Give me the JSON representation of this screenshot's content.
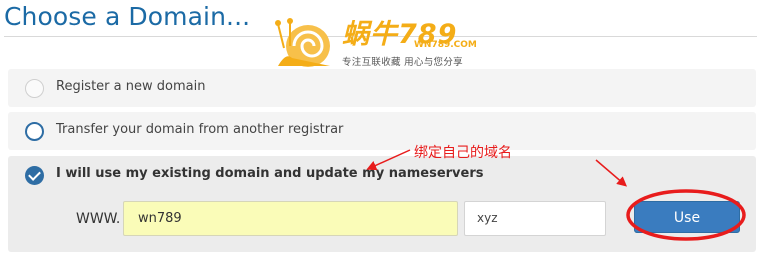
{
  "header": {
    "title": "Choose a Domain..."
  },
  "watermark": {
    "brand": "蜗牛789",
    "domain": "WN789.COM",
    "tagline": "专注互联收藏    用心与您分享"
  },
  "options": [
    {
      "label": "Register a new domain",
      "state": "unselected"
    },
    {
      "label": "Transfer your domain from another registrar",
      "state": "hover"
    },
    {
      "label": "I will use my existing domain and update my nameservers",
      "state": "selected"
    }
  ],
  "domain_form": {
    "prefix": "WWW.",
    "domain_value": "wn789",
    "tld_value": "xyz",
    "use_button": "Use"
  },
  "annotation": {
    "text": "绑定自己的域名",
    "color": "#e81c1c"
  },
  "colors": {
    "accent": "#2e6da4",
    "title": "#1b6aa5",
    "input_highlight": "#fafcb8"
  }
}
